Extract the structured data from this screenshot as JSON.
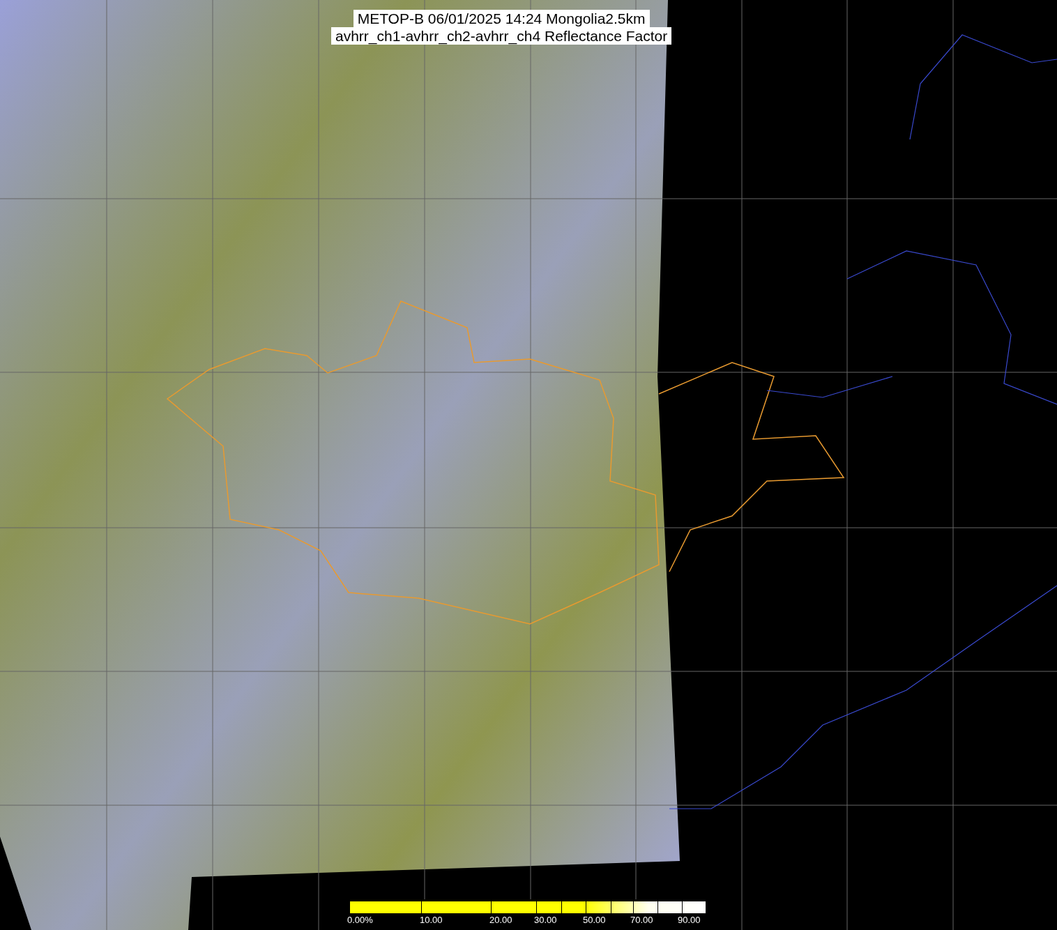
{
  "title": {
    "lines": [
      "METOP-B 06/01/2025 14:24 Mongolia2.5km",
      "avhrr_ch1-avhrr_ch2-avhrr_ch4 Reflectance Factor"
    ]
  },
  "colorbar": {
    "labels": [
      "0.00%",
      "10.00",
      "20.00",
      "30.00",
      "50.00",
      "70.00",
      "90.00"
    ]
  }
}
